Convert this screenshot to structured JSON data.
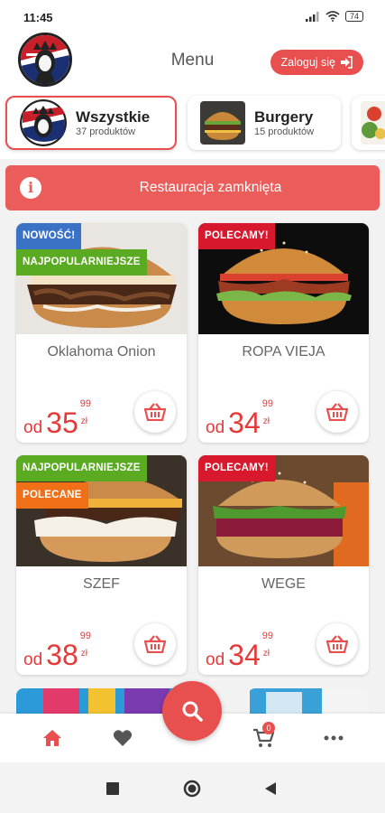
{
  "status_bar": {
    "time": "11:45",
    "battery": "74"
  },
  "header": {
    "title": "Menu",
    "login_label": "Zaloguj się"
  },
  "categories": [
    {
      "name": "Wszystkie",
      "count": "37 produktów",
      "active": true
    },
    {
      "name": "Burgery",
      "count": "15 produktów",
      "active": false
    }
  ],
  "banner": {
    "text": "Restauracja zamknięta",
    "icon": "info-icon"
  },
  "products": [
    {
      "name": "Oklahoma Onion",
      "badges": [
        "NOWOŚĆ!",
        "NAJPOPULARNIEJSZE"
      ],
      "price_prefix": "od",
      "price_main": "35",
      "price_cents": "99",
      "currency": "zł"
    },
    {
      "name": "ROPA VIEJA",
      "badges": [
        "POLECAMY!"
      ],
      "price_prefix": "od",
      "price_main": "34",
      "price_cents": "99",
      "currency": "zł"
    },
    {
      "name": "SZEF",
      "badges": [
        "NAJPOPULARNIEJSZE",
        "POLECANE"
      ],
      "price_prefix": "od",
      "price_main": "38",
      "price_cents": "99",
      "currency": "zł"
    },
    {
      "name": "WEGE",
      "badges": [
        "POLECAMY!"
      ],
      "price_prefix": "od",
      "price_main": "34",
      "price_cents": "99",
      "currency": "zł"
    }
  ],
  "bottom_nav": {
    "items": [
      "home-icon",
      "heart-icon",
      "search-icon",
      "cart-icon",
      "more-icon"
    ],
    "cart_count": "0"
  },
  "colors": {
    "accent": "#e84f4f",
    "badge_blue": "#3a72c5",
    "badge_green": "#5aaa22",
    "badge_orange": "#f07018",
    "badge_red": "#d8182c"
  }
}
